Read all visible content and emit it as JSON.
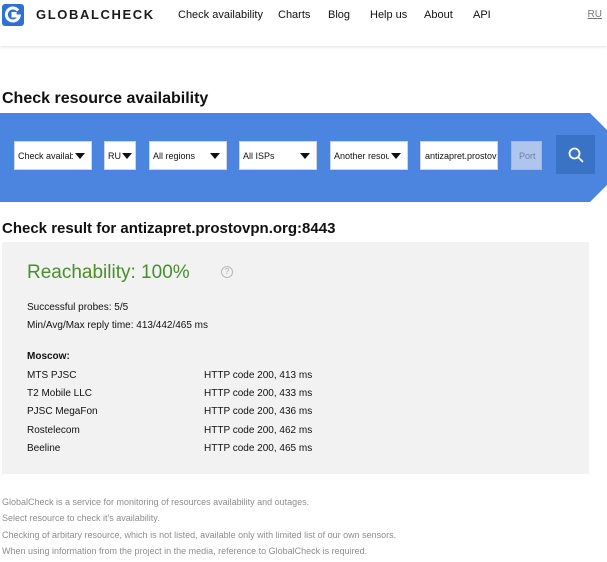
{
  "header": {
    "brand": "GLOBALCHECK",
    "nav": [
      "Check availability",
      "Charts",
      "Blog",
      "Help us",
      "About",
      "API"
    ],
    "lang": "RU"
  },
  "page_title": "Check resource availability",
  "form": {
    "check_type": "Check availability",
    "country": "RU",
    "region": "All regions",
    "isp": "All ISPs",
    "resource": "Another resource",
    "host": "antizapret.prostovpn.org",
    "port_placeholder": "Port",
    "colors": {
      "banner": "#4b85e0",
      "button": "#3a73c6"
    }
  },
  "result": {
    "title": "Check result for antizapret.prostovpn.org:8443",
    "reachability": "Reachability: 100%",
    "successful_probes": "Successful probes: 5/5",
    "reply_time": "Min/Avg/Max reply time: 413/442/465 ms",
    "city": "Moscow:",
    "rows": [
      {
        "isp": "MTS PJSC",
        "status": "HTTP code 200, 413 ms"
      },
      {
        "isp": "T2 Mobile LLC",
        "status": "HTTP code 200, 433 ms"
      },
      {
        "isp": "PJSC MegaFon",
        "status": "HTTP code 200, 436 ms"
      },
      {
        "isp": "Rostelecom",
        "status": "HTTP code 200, 462 ms"
      },
      {
        "isp": "Beeline",
        "status": "HTTP code 200, 465 ms"
      }
    ],
    "success_color": "#4a8f2e"
  },
  "footer": [
    "GlobalCheck is a service for monitoring of resources availability and outages.",
    "Select resource to check it's availability.",
    "Checking of arbitary resource, which is not listed, available only with limited list of our own sensors.",
    "When using information from the project in the media, reference to GlobalCheck is required."
  ],
  "icons": {
    "logo": "globalcheck-logo",
    "search": "search-icon",
    "help": "help-icon"
  }
}
